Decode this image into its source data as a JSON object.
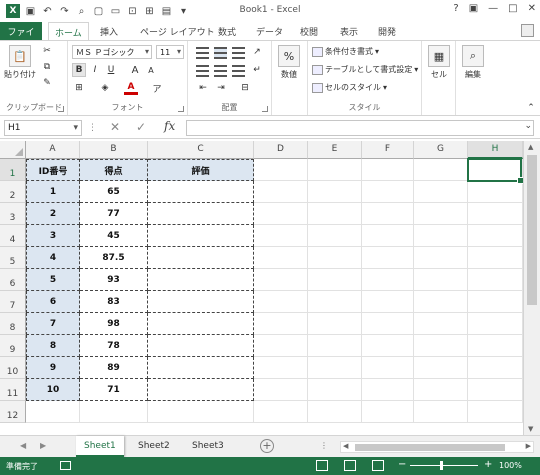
{
  "window": {
    "title": "Book1 - Excel",
    "controls": [
      "?",
      "▣",
      "—",
      "□",
      "✕"
    ]
  },
  "qat": {
    "icons": [
      "save-icon",
      "undo-icon",
      "redo-icon",
      "print-preview-icon",
      "new-icon",
      "open-icon",
      "save-as-icon",
      "table-icon",
      "chart-icon"
    ]
  },
  "tabs": [
    "ファイル",
    "ホーム",
    "挿入",
    "ページ レイアウト",
    "数式",
    "データ",
    "校閲",
    "表示",
    "開発"
  ],
  "ribbon": {
    "clipboard": {
      "paste": "貼り付け",
      "label": "クリップボード"
    },
    "font": {
      "name": "ＭＳ Ｐゴシック",
      "size": "11",
      "bold": "B",
      "italic": "I",
      "underline": "U",
      "grow": "A",
      "shrink": "A",
      "label": "フォント"
    },
    "alignment": {
      "label": "配置"
    },
    "number": {
      "percent": "%",
      "label": "数値"
    },
    "styles": {
      "conditional": "条件付き書式",
      "as_table": "テーブルとして書式設定",
      "cell_styles": "セルのスタイル",
      "label": "スタイル"
    },
    "cells": {
      "label": "セル"
    },
    "editing": {
      "label": "編集"
    }
  },
  "formula_bar": {
    "name_box": "H1",
    "fx": "fx",
    "formula": ""
  },
  "columns": [
    "A",
    "B",
    "C",
    "D",
    "E",
    "F",
    "G",
    "H"
  ],
  "rows": [
    "1",
    "2",
    "3",
    "4",
    "5",
    "6",
    "7",
    "8",
    "9",
    "10",
    "11",
    "12"
  ],
  "table": {
    "headers": [
      "ID番号",
      "得点",
      "評価"
    ],
    "ids": [
      "1",
      "2",
      "3",
      "4",
      "5",
      "6",
      "7",
      "8",
      "9",
      "10"
    ],
    "scores": [
      "65",
      "77",
      "45",
      "87.5",
      "93",
      "83",
      "98",
      "78",
      "89",
      "71"
    ]
  },
  "selected_cell": "H1",
  "sheets": [
    "Sheet1",
    "Sheet2",
    "Sheet3"
  ],
  "active_sheet": "Sheet1",
  "status": {
    "text": "準備完了",
    "zoom": "100%"
  },
  "colors": {
    "accent": "#217346",
    "header_fill": "#dce6f1"
  }
}
